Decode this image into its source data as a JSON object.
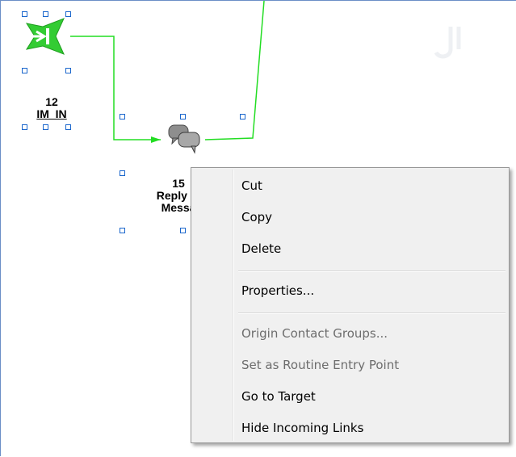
{
  "canvas": {
    "nodes": [
      {
        "number": "12",
        "name": "IM_IN"
      },
      {
        "number": "15",
        "name_line1": "Reply In",
        "name_line2": "Messa"
      }
    ],
    "colors": {
      "link": "#22dd22",
      "node_icon": "#33cc33",
      "selection_handle": "#1a66cc"
    },
    "icons": {
      "im_in": "green-entry-arrow-icon",
      "reply": "chat-bubbles-icon"
    }
  },
  "context_menu": {
    "items": [
      {
        "label": "Cut",
        "enabled": true
      },
      {
        "label": "Copy",
        "enabled": true
      },
      {
        "label": "Delete",
        "enabled": true
      },
      {
        "label": "Properties...",
        "enabled": true
      },
      {
        "label": "Origin Contact Groups...",
        "enabled": false
      },
      {
        "label": "Set as Routine Entry Point",
        "enabled": false
      },
      {
        "label": "Go to Target",
        "enabled": true
      },
      {
        "label": "Hide Incoming Links",
        "enabled": true
      }
    ]
  }
}
